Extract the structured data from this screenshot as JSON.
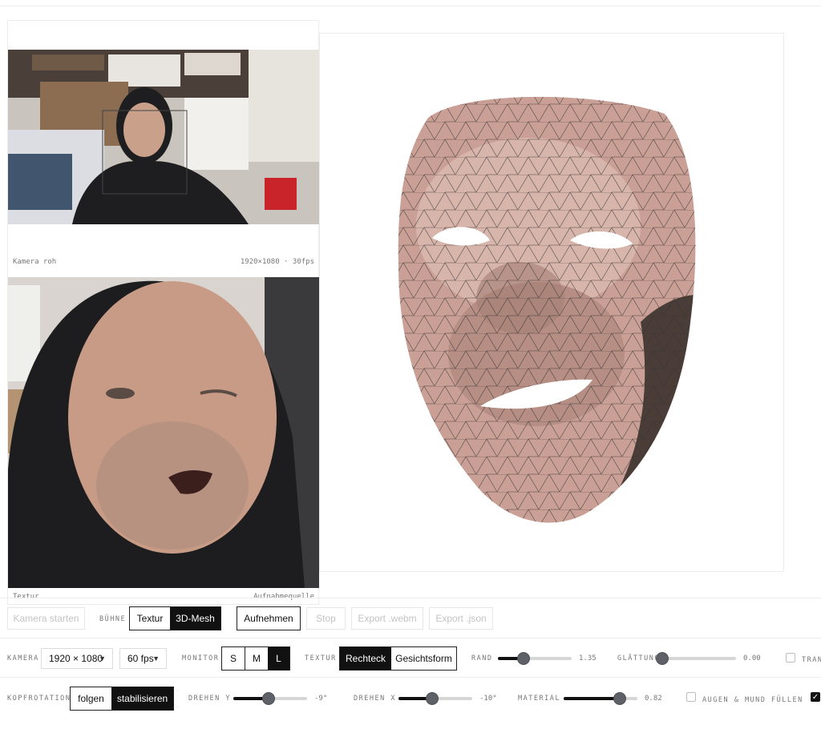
{
  "preview": {
    "raw_caption": "Kamera roh",
    "raw_meta": "1920×1080 · 30fps",
    "texture_caption": "Textur",
    "texture_source": "Aufnahmequelle"
  },
  "row1": {
    "camera_start": "Kamera starten",
    "stage_label": "BÜHNE",
    "stage_options": [
      "Textur",
      "3D-Mesh"
    ],
    "stage_selected": "3D-Mesh",
    "record": "Aufnehmen",
    "stop": "Stop",
    "export_webm": "Export .webm",
    "export_json": "Export .json"
  },
  "row2": {
    "camera_label": "KAMERA",
    "resolution": "1920 × 1080",
    "fps": "60 fps",
    "monitor_label": "MONITOR",
    "monitor_options": [
      "S",
      "M",
      "L"
    ],
    "monitor_selected": "L",
    "texture_label": "TEXTUR",
    "texture_options": [
      "Rechteck",
      "Gesichtsform"
    ],
    "texture_selected": "Rechteck",
    "rand_label": "RAND",
    "rand_value": "1.35",
    "rand_level": 0.35,
    "smooth_label": "GLÄTTUNG",
    "smooth_value": "0.00",
    "smooth_level": 0.0,
    "trans_label": "TRAN"
  },
  "row3": {
    "headrot_label": "KOPFROTATION",
    "headrot_options": [
      "folgen",
      "stabilisieren"
    ],
    "headrot_selected": "stabilisieren",
    "rot_y_label": "DREHEN Y",
    "rot_y_value": "-9°",
    "rot_y_level": 0.48,
    "rot_x_label": "DREHEN X",
    "rot_x_value": "-10°",
    "rot_x_level": 0.46,
    "material_label": "MATERIAL",
    "material_value": "0.82",
    "material_level": 0.76,
    "fill_label": "AUGEN & MUND FÜLLEN",
    "fill_checked": false
  },
  "colors": {
    "accent": "#111111",
    "thumb": "#5f6168",
    "border": "#ececec",
    "skin": "#c9a79c"
  }
}
